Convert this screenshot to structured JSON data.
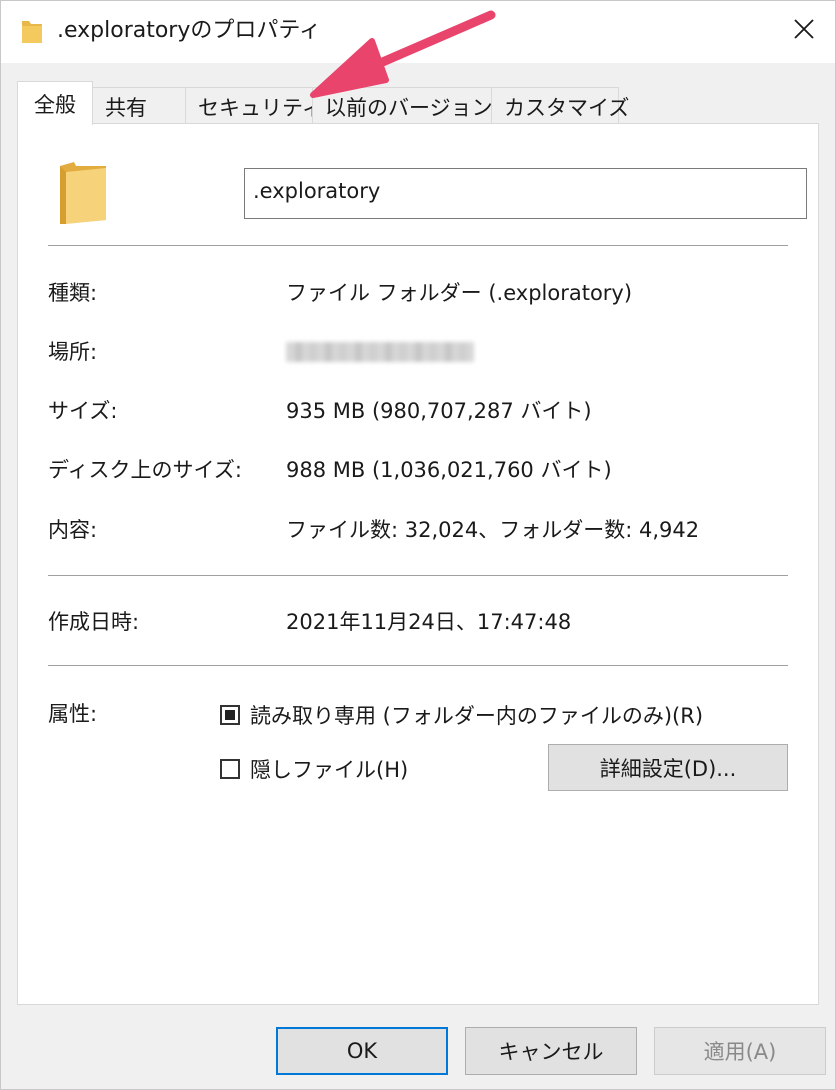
{
  "window": {
    "title": ".exploratoryのプロパティ"
  },
  "tabs": [
    {
      "label": "全般",
      "active": true
    },
    {
      "label": "共有",
      "active": false
    },
    {
      "label": "セキュリティ",
      "active": false
    },
    {
      "label": "以前のバージョン",
      "active": false
    },
    {
      "label": "カスタマイズ",
      "active": false
    }
  ],
  "general": {
    "name_value": ".exploratory",
    "type_label": "種類:",
    "type_value": "ファイル フォルダー (.exploratory)",
    "location_label": "場所:",
    "size_label": "サイズ:",
    "size_value": "935 MB (980,707,287 バイト)",
    "disk_size_label": "ディスク上のサイズ:",
    "disk_size_value": "988 MB (1,036,021,760 バイト)",
    "contents_label": "内容:",
    "contents_value": "ファイル数: 32,024、フォルダー数: 4,942",
    "created_label": "作成日時:",
    "created_value": "2021年11月24日、17:47:48",
    "attributes_label": "属性:",
    "readonly_label": "読み取り専用 (フォルダー内のファイルのみ)(R)",
    "readonly_state": "indeterminate",
    "hidden_label": "隠しファイル(H)",
    "hidden_state": "unchecked",
    "advanced_button": "詳細設定(D)..."
  },
  "buttons": {
    "ok": "OK",
    "cancel": "キャンセル",
    "apply": "適用(A)"
  },
  "colors": {
    "folder": "#f4c95d",
    "focus_border": "#0078d7",
    "annotation_arrow": "#e8446c"
  },
  "icons": {
    "title_icon": "folder-icon",
    "close": "close-icon",
    "big_icon": "folder-icon"
  }
}
